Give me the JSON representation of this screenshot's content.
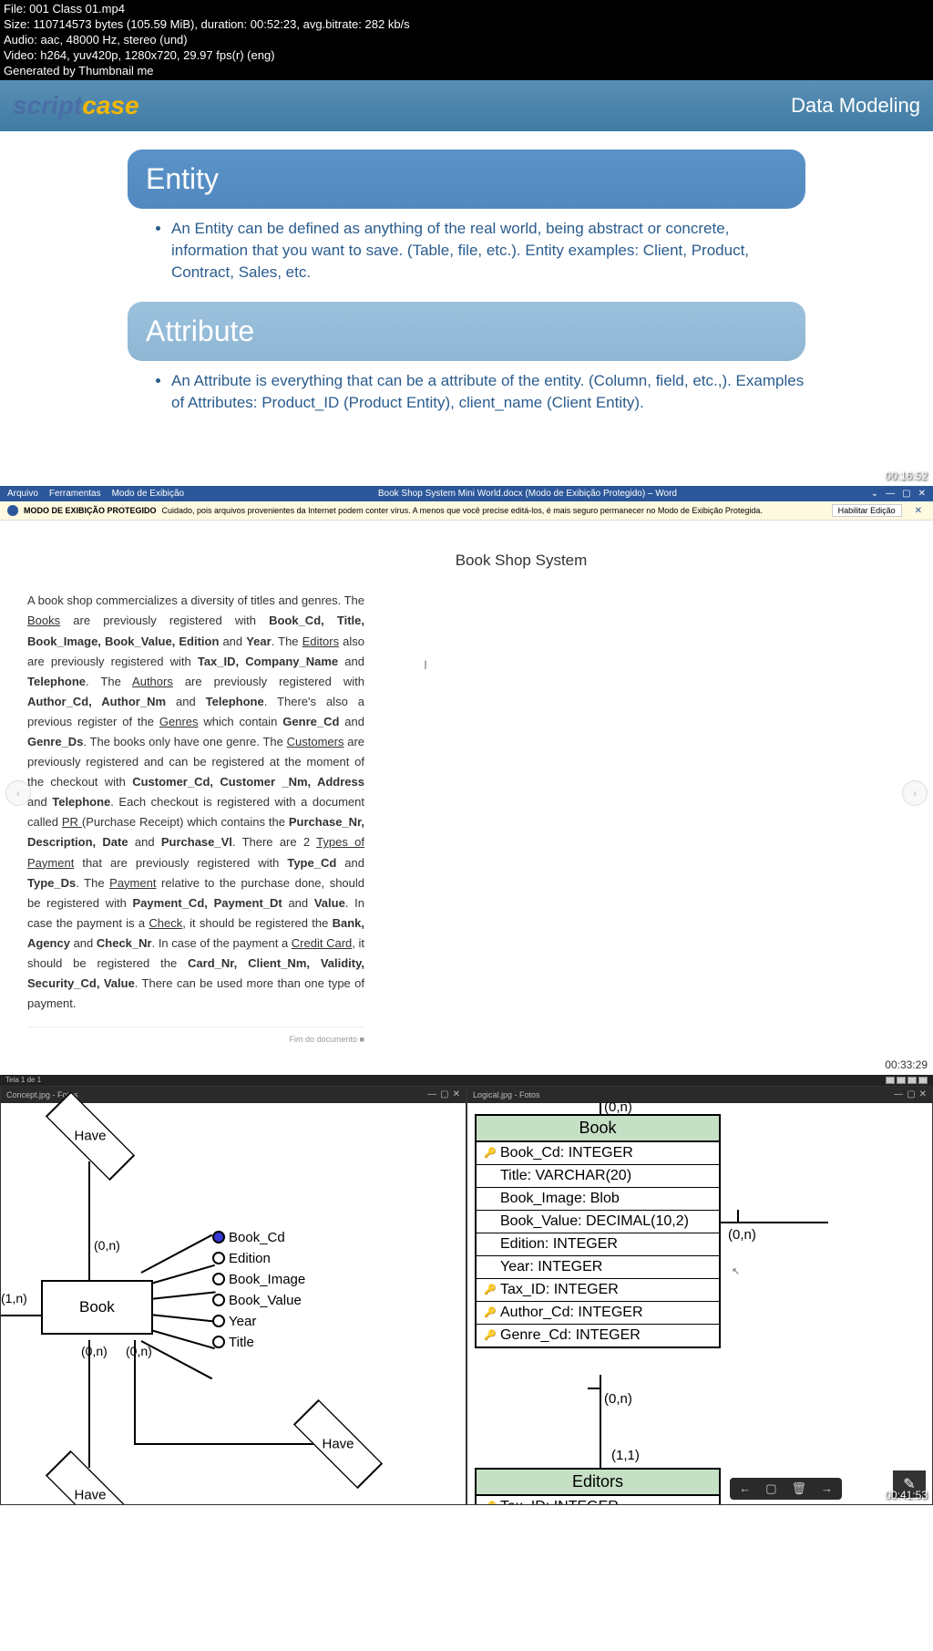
{
  "info": {
    "file": "File: 001 Class 01.mp4",
    "size": "Size: 110714573 bytes (105.59 MiB), duration: 00:52:23, avg.bitrate: 282 kb/s",
    "audio": "Audio: aac, 48000 Hz, stereo (und)",
    "video": "Video: h264, yuv420p, 1280x720, 29.97 fps(r) (eng)",
    "gen": "Generated by Thumbnail me"
  },
  "thumb1": {
    "timestamp": "00:16:52",
    "logo_script": "script",
    "logo_case": "case",
    "title": "Data Modeling",
    "entity_label": "Entity",
    "entity_desc": "An Entity can be defined as anything of the real world, being abstract or concrete, information that you want to save. (Table, file, etc.). Entity examples: Client, Product, Contract, Sales, etc.",
    "attribute_label": "Attribute",
    "attribute_desc": "An Attribute is everything that can be a attribute of the entity. (Column, field, etc.,). Examples of Attributes: Product_ID (Product Entity), client_name (Client Entity)."
  },
  "thumb2": {
    "timestamp": "00:33:29",
    "menu": [
      "Arquivo",
      "Ferramentas",
      "Modo de Exibição"
    ],
    "doc_title_bar": "Book Shop System Mini World.docx (Modo de Exibição Protegido) – Word",
    "protect_label": "MODO DE EXIBIÇÃO PROTEGIDO",
    "protect_msg": "Cuidado, pois arquivos provenientes da Internet podem conter vírus. A menos que você precise editá-los, é mais seguro permanecer no Modo de Exibição Protegida.",
    "protect_btn": "Habilitar Edição",
    "doc_title": "Book Shop System",
    "footer": "Fim do documento  ■"
  },
  "thumb3": {
    "timestamp": "00:41:53",
    "left_title": "Concept.jpg - Fotos",
    "right_title": "Logical.jpg - Fotos",
    "taskbar": "Tela 1 de 1",
    "er": {
      "entity": "Book",
      "have": "Have",
      "attrs": [
        "Book_Cd",
        "Edition",
        "Book_Image",
        "Book_Value",
        "Year",
        "Title"
      ],
      "card_0n": "(0,n)",
      "card_1n": "(1,n)"
    },
    "table1": {
      "name": "Book",
      "cols": [
        {
          "key": "pk",
          "text": "Book_Cd: INTEGER"
        },
        {
          "key": "",
          "text": "Title: VARCHAR(20)"
        },
        {
          "key": "",
          "text": "Book_Image: Blob"
        },
        {
          "key": "",
          "text": "Book_Value: DECIMAL(10,2)"
        },
        {
          "key": "",
          "text": "Edition: INTEGER"
        },
        {
          "key": "",
          "text": "Year: INTEGER"
        },
        {
          "key": "fk",
          "text": "Tax_ID: INTEGER"
        },
        {
          "key": "fk",
          "text": "Author_Cd: INTEGER"
        },
        {
          "key": "fk",
          "text": "Genre_Cd: INTEGER"
        }
      ]
    },
    "table2": {
      "name": "Editors",
      "cols": [
        {
          "key": "pk",
          "text": "Tax_ID: INTEGER"
        }
      ]
    },
    "rel": {
      "top": "(0,n)",
      "mid1": "(0,n)",
      "mid2": "(1,1)",
      "right": "(0,n)"
    }
  }
}
